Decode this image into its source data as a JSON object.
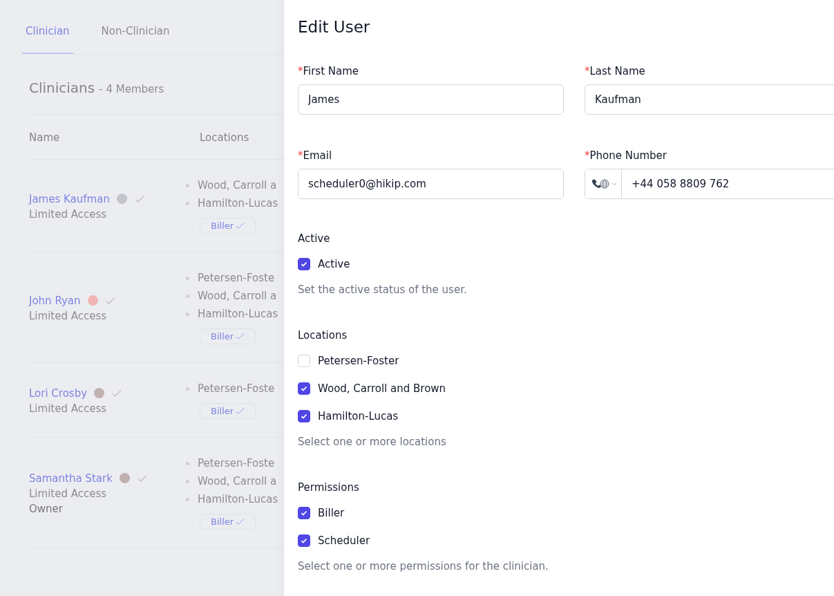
{
  "tabs": [
    {
      "label": "Clinician",
      "selected": true
    },
    {
      "label": "Non-Clinician",
      "selected": false
    }
  ],
  "heading": {
    "title": "Clinicians",
    "subtitle": "- 4 Members"
  },
  "table": {
    "columns": [
      "Name",
      "Locations"
    ],
    "rows": [
      {
        "name": "James Kaufman",
        "color": "#c4c4cc",
        "roles": [
          "Limited Access"
        ],
        "locations": [
          "Wood, Carroll a",
          "Hamilton-Lucas"
        ],
        "badges": [
          "Biller"
        ]
      },
      {
        "name": "John Ryan",
        "color": "#f0b4b4",
        "roles": [
          "Limited Access"
        ],
        "locations": [
          "Petersen-Foste",
          "Wood, Carroll a",
          "Hamilton-Lucas"
        ],
        "badges": [
          "Biller"
        ]
      },
      {
        "name": "Lori Crosby",
        "color": "#c0b0b0",
        "roles": [
          "Limited Access"
        ],
        "locations": [
          "Petersen-Foste"
        ],
        "badges": [
          "Biller"
        ]
      },
      {
        "name": "Samantha Stark",
        "color": "#c0b0b0",
        "roles": [
          "Limited Access",
          "Owner"
        ],
        "locations": [
          "Petersen-Foste",
          "Wood, Carroll a",
          "Hamilton-Lucas"
        ],
        "badges": [
          "Biller"
        ]
      }
    ]
  },
  "drawer": {
    "title": "Edit User",
    "fields": [
      {
        "kind": "text",
        "required_mark": "*",
        "label": "First Name",
        "value": "James"
      },
      {
        "kind": "text",
        "required_mark": "*",
        "label": "Last Name",
        "value": "Kaufman"
      },
      {
        "kind": "text",
        "required_mark": "*",
        "label": "Email",
        "value": "scheduler0@hikip.com"
      },
      {
        "kind": "phone",
        "required_mark": "*",
        "label": "Phone Number",
        "value": "+44 058 8809 762"
      }
    ],
    "groups": [
      {
        "title": "Active",
        "options": [
          {
            "label": "Active",
            "checked": true
          }
        ],
        "help": "Set the active status of the user."
      },
      {
        "title": "Locations",
        "options": [
          {
            "label": "Petersen-Foster",
            "checked": false
          },
          {
            "label": "Wood, Carroll and Brown",
            "checked": true
          },
          {
            "label": "Hamilton-Lucas",
            "checked": true
          }
        ],
        "help": "Select one or more locations"
      },
      {
        "title": "Permissions",
        "options": [
          {
            "label": "Biller",
            "checked": true
          },
          {
            "label": "Scheduler",
            "checked": true
          }
        ],
        "help": "Select one or more permissions for the clinician."
      }
    ]
  }
}
